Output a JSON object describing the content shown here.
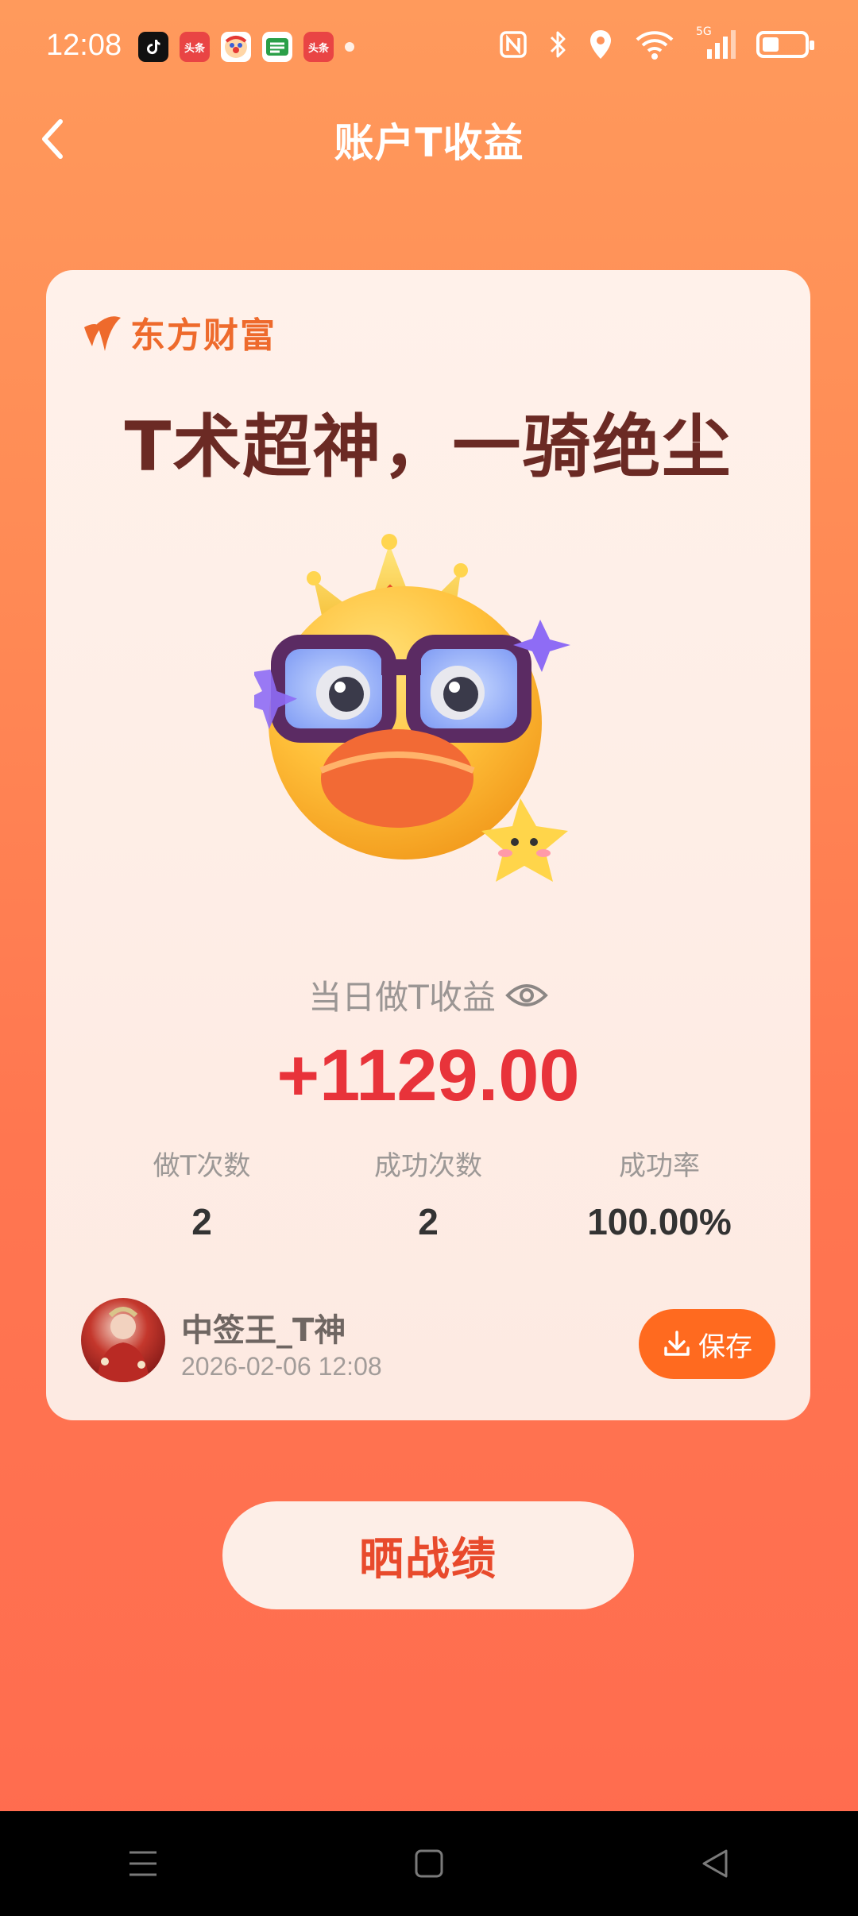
{
  "status_bar": {
    "time": "12:08",
    "apps": [
      {
        "name": "tiktok-app-icon",
        "label": "♪",
        "color": "#111111"
      },
      {
        "name": "toutiao-app-icon",
        "label": "头条",
        "color": "#e94444"
      },
      {
        "name": "clown-app-icon",
        "label": "",
        "color": "#ffffff"
      },
      {
        "name": "post-app-icon",
        "label": "",
        "color": "#2a9f48"
      },
      {
        "name": "toutiao-lite-app-icon",
        "label": "头条",
        "color": "#e94444"
      }
    ],
    "network": "5G"
  },
  "header": {
    "title": "账户T收益"
  },
  "card": {
    "brand": "东方财富",
    "slogan": "T术超神，一骑绝尘",
    "profit_label": "当日做T收益",
    "profit_value": "+1129.00",
    "stats": [
      {
        "label": "做T次数",
        "value": "2"
      },
      {
        "label": "成功次数",
        "value": "2"
      },
      {
        "label": "成功率",
        "value": "100.00%"
      }
    ],
    "user": {
      "name": "中签王_T神",
      "time": "2026-02-06 12:08"
    },
    "save_label": "保存"
  },
  "share_label": "晒战绩",
  "colors": {
    "background_top": "#ff9a5c",
    "background_bottom": "#ff6b4f",
    "card_bg": "#fff1ea",
    "slogan": "#6b2a24",
    "profit": "#e8333a",
    "accent": "#ff6a1f",
    "brand": "#ee6a2c"
  }
}
